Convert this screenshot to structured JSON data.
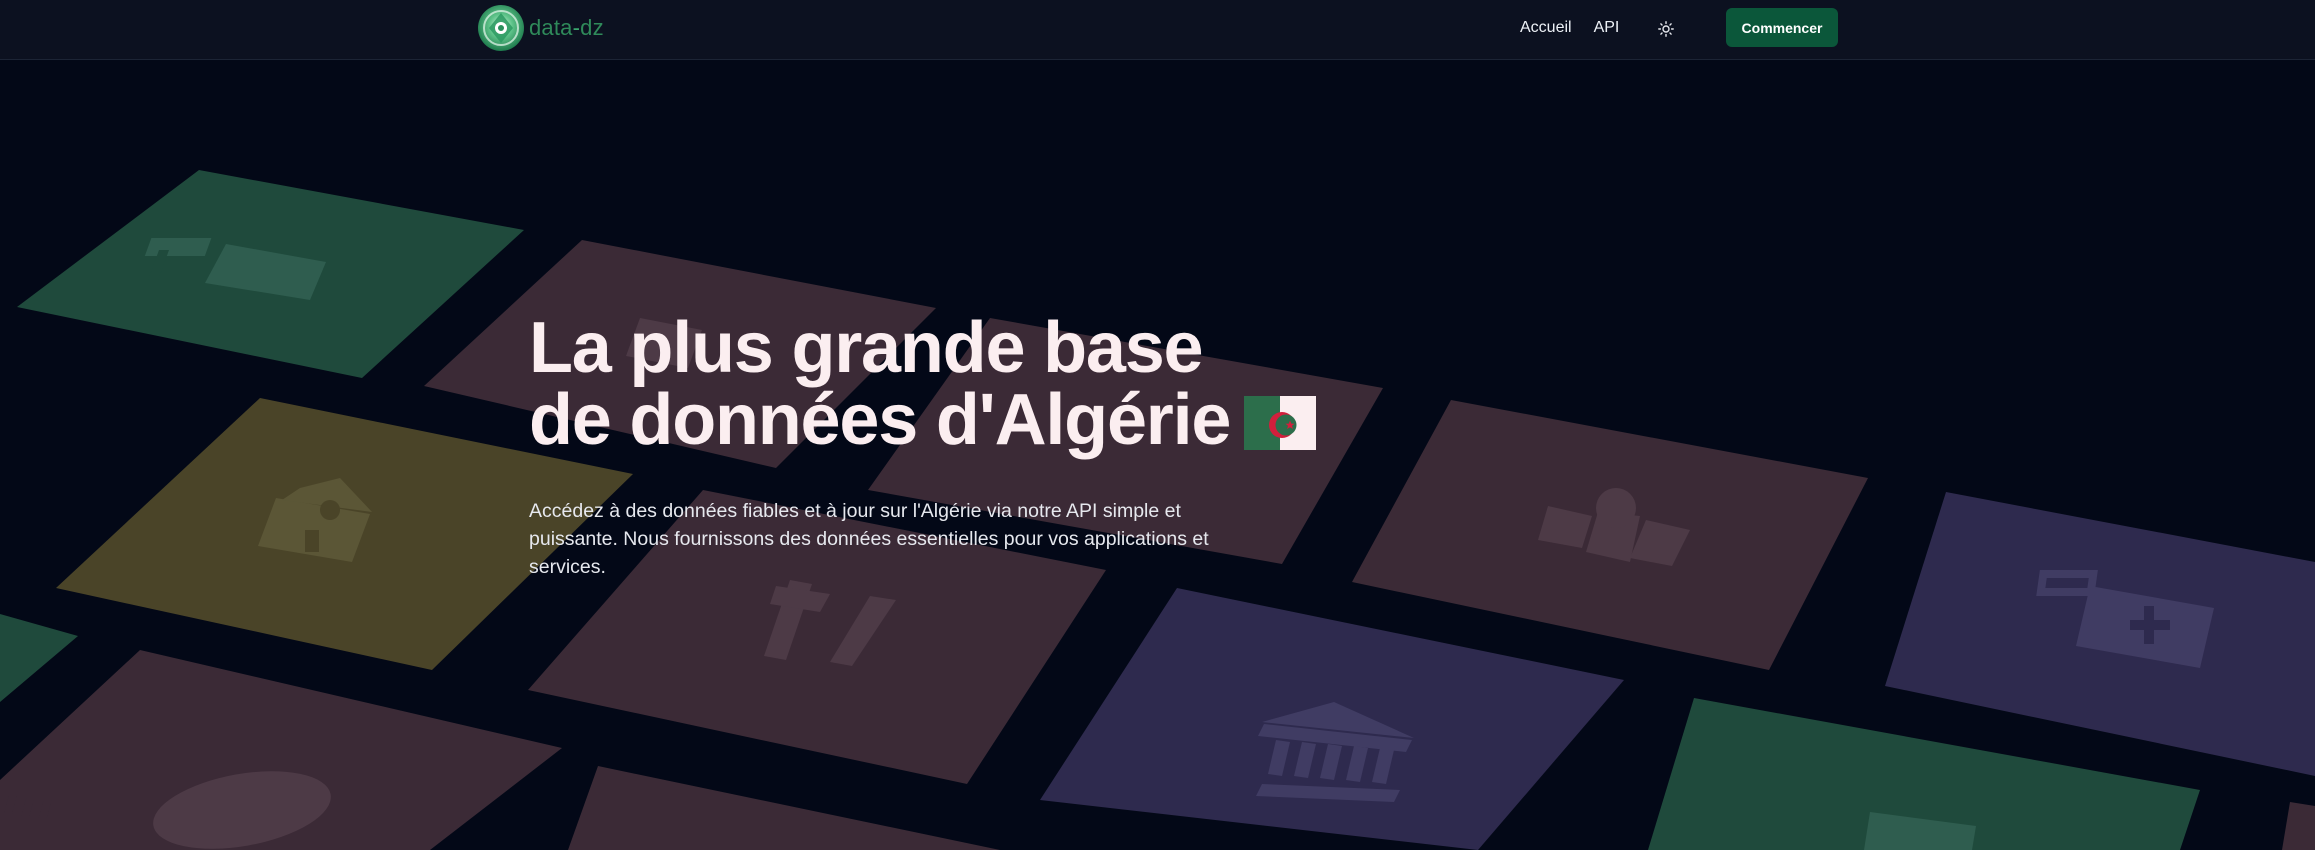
{
  "brand": {
    "name_part1": "data",
    "separator": "-",
    "name_part2": "dz",
    "logo_icon": "data-dz-logo-icon"
  },
  "nav": {
    "links": [
      {
        "label": "Accueil"
      },
      {
        "label": "API"
      }
    ],
    "theme_toggle_icon": "sun-icon",
    "cta_label": "Commencer"
  },
  "hero": {
    "title_line1": "La plus grande base",
    "title_line2": "de données d'Algérie",
    "flag_icon": "algeria-flag-icon",
    "description": "Accédez à des données fiables et à jour sur l'Algérie via notre API simple et puissante. Nous fournissons des données essentielles pour vos applications et services."
  },
  "background_tiles": [
    {
      "icon": "hospital-icon",
      "color": "#1f4a3c"
    },
    {
      "icon": "building-icon",
      "color": "#3b2a36"
    },
    {
      "icon": "school-icon",
      "color": "#4a4428"
    },
    {
      "icon": "restaurant-icon",
      "color": "#3b2a36"
    },
    {
      "icon": "map-icon",
      "color": "#3b2a36"
    },
    {
      "icon": "bank-icon",
      "color": "#2e2a4e"
    },
    {
      "icon": "medical-kit-icon",
      "color": "#2e2a4e"
    },
    {
      "icon": "football-icon",
      "color": "#3b2a36"
    },
    {
      "icon": "bus-icon",
      "color": "#1f4a3c"
    }
  ],
  "colors": {
    "background": "#030817",
    "navbar": "#0c1120",
    "accent_green": "#0b573a",
    "title": "#fbeef0"
  }
}
